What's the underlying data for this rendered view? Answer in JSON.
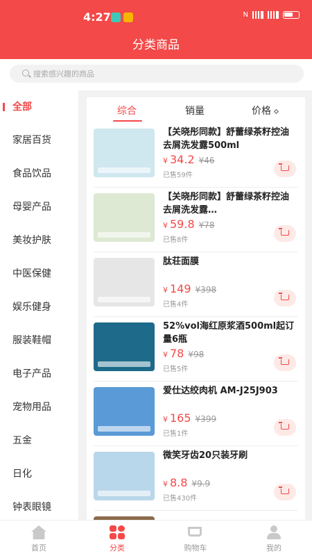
{
  "status": {
    "time": "4:27",
    "network": "4G 5G"
  },
  "header": {
    "title": "分类商品"
  },
  "search": {
    "placeholder": "搜索感兴趣的商品"
  },
  "sidebar": {
    "items": [
      {
        "label": "全部"
      },
      {
        "label": "家居百货"
      },
      {
        "label": "食品饮品"
      },
      {
        "label": "母婴产品"
      },
      {
        "label": "美妆护肤"
      },
      {
        "label": "中医保健"
      },
      {
        "label": "娱乐健身"
      },
      {
        "label": "服装鞋帽"
      },
      {
        "label": "电子产品"
      },
      {
        "label": "宠物用品"
      },
      {
        "label": "五金"
      },
      {
        "label": "日化"
      },
      {
        "label": "钟表眼镜"
      }
    ]
  },
  "sort": {
    "comprehensive": "综合",
    "sales": "销量",
    "price": "价格"
  },
  "products": [
    {
      "name": "【关晓彤同款】舒蕾绿茶籽控油去屑洗发露500ml",
      "currency": "¥",
      "price": "34.2",
      "original": "¥46",
      "sold": "已售59件",
      "color": "#cfe7ef"
    },
    {
      "name": "【关晓彤同款】舒蕾绿茶籽控油去屑洗发露…",
      "currency": "¥",
      "price": "59.8",
      "original": "¥78",
      "sold": "已售8件",
      "color": "#dde9d3"
    },
    {
      "name": "肽荘面膜",
      "currency": "¥",
      "price": "149",
      "original": "¥398",
      "sold": "已售4件",
      "color": "#e6e6e6"
    },
    {
      "name": "52%vol海红原浆酒500ml起订量6瓶",
      "currency": "¥",
      "price": "78",
      "original": "¥98",
      "sold": "已售5件",
      "color": "#1d6a8a"
    },
    {
      "name": "爱仕达绞肉机 AM-J25J903",
      "currency": "¥",
      "price": "165",
      "original": "¥399",
      "sold": "已售1件",
      "color": "#5a9ad6"
    },
    {
      "name": "微笑牙齿20只装牙刷",
      "currency": "¥",
      "price": "8.8",
      "original": "¥9.9",
      "sold": "已售430件",
      "color": "#b9d7ea"
    },
    {
      "name": "",
      "currency": "",
      "price": "",
      "original": "",
      "sold": "",
      "color": "#8b6a4a"
    }
  ],
  "tabbar": {
    "home": "首页",
    "category": "分类",
    "cart": "购物车",
    "me": "我的"
  },
  "colors": {
    "brand": "#f34948",
    "page_bg": "#f2f2f2"
  }
}
